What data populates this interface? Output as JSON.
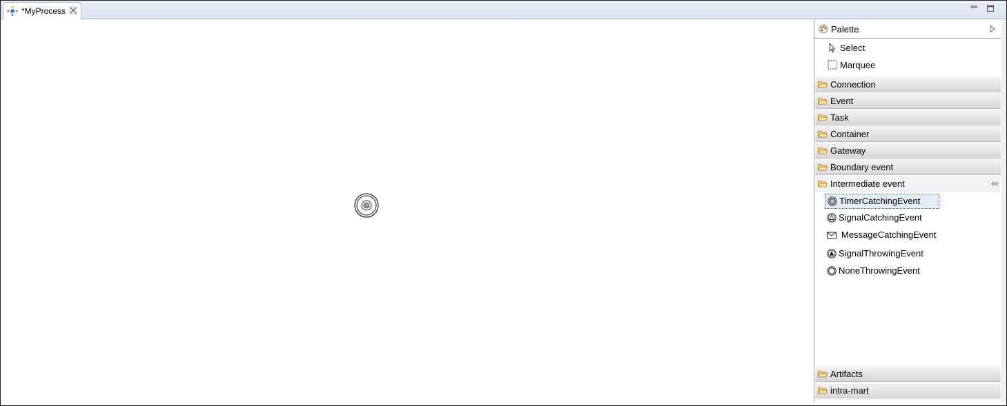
{
  "editor": {
    "tab_title": "*MyProcess"
  },
  "palette": {
    "title": "Palette",
    "tools": [
      {
        "label": "Select",
        "icon": "cursor-arrow-icon"
      },
      {
        "label": "Marquee",
        "icon": "marquee-icon"
      }
    ],
    "drawers": [
      {
        "label": "Connection",
        "open": false
      },
      {
        "label": "Event",
        "open": false
      },
      {
        "label": "Task",
        "open": false
      },
      {
        "label": "Container",
        "open": false
      },
      {
        "label": "Gateway",
        "open": false
      },
      {
        "label": "Boundary event",
        "open": false
      },
      {
        "label": "Intermediate event",
        "open": true
      },
      {
        "label": "Artifacts",
        "open": false
      },
      {
        "label": "intra-mart",
        "open": false
      }
    ],
    "intermediate_entries": [
      {
        "label": "TimerCatchingEvent",
        "icon": "timer-event-icon",
        "selected": true
      },
      {
        "label": "SignalCatchingEvent",
        "icon": "signal-catch-icon",
        "selected": false
      },
      {
        "label": "MessageCatchingEvent",
        "icon": "envelope-icon",
        "selected": false
      },
      {
        "label": "SignalThrowingEvent",
        "icon": "signal-throw-icon",
        "selected": false
      },
      {
        "label": "NoneThrowingEvent",
        "icon": "none-event-icon",
        "selected": false
      }
    ]
  },
  "colors": {
    "selection": "#e4ecf7",
    "folder": "#e8a838",
    "tabbar": "#dbe3f0"
  }
}
